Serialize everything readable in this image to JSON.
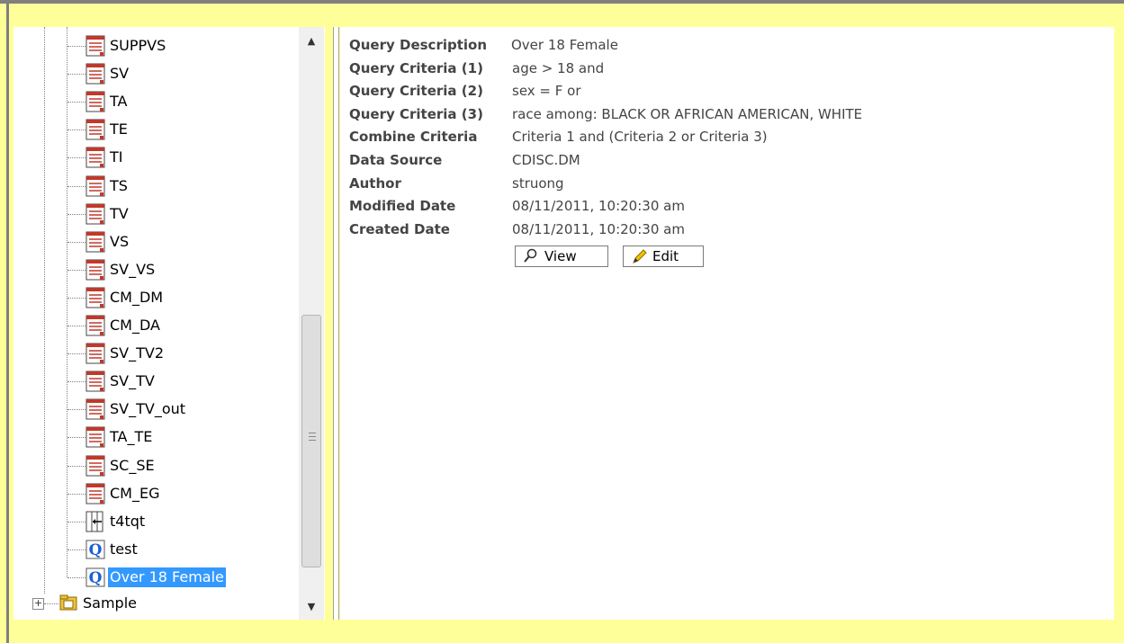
{
  "tree": {
    "items": [
      {
        "label": "SUPPVS",
        "icon": "table-icon"
      },
      {
        "label": "SV",
        "icon": "table-icon"
      },
      {
        "label": "TA",
        "icon": "table-icon"
      },
      {
        "label": "TE",
        "icon": "table-icon"
      },
      {
        "label": "TI",
        "icon": "table-icon"
      },
      {
        "label": "TS",
        "icon": "table-icon"
      },
      {
        "label": "TV",
        "icon": "table-icon"
      },
      {
        "label": "VS",
        "icon": "table-icon"
      },
      {
        "label": "SV_VS",
        "icon": "table-icon"
      },
      {
        "label": "CM_DM",
        "icon": "table-icon"
      },
      {
        "label": "CM_DA",
        "icon": "table-icon"
      },
      {
        "label": "SV_TV2",
        "icon": "table-icon"
      },
      {
        "label": "SV_TV",
        "icon": "table-icon"
      },
      {
        "label": "SV_TV_out",
        "icon": "table-icon"
      },
      {
        "label": "TA_TE",
        "icon": "table-icon"
      },
      {
        "label": "SC_SE",
        "icon": "table-icon"
      },
      {
        "label": "CM_EG",
        "icon": "table-icon"
      },
      {
        "label": "t4tqt",
        "icon": "transpose-icon"
      },
      {
        "label": "test",
        "icon": "query-icon"
      },
      {
        "label": "Over 18 Female",
        "icon": "query-icon",
        "selected": true
      }
    ],
    "folder": {
      "label": "Sample",
      "icon": "folder-icon",
      "expander": "+"
    },
    "scroll": {
      "up": "▲",
      "down": "▼",
      "grip": "≡"
    }
  },
  "details": {
    "rows": [
      {
        "key": "Query Description",
        "value": "Over 18 Female"
      },
      {
        "key": "Query Criteria (1)",
        "value": "age > 18 and"
      },
      {
        "key": "Query Criteria (2)",
        "value": "sex = F or"
      },
      {
        "key": "Query Criteria (3)",
        "value": "race among: BLACK OR AFRICAN AMERICAN, WHITE"
      },
      {
        "key": "Combine Criteria",
        "value": "Criteria 1 and (Criteria 2 or Criteria 3)"
      },
      {
        "key": "Data Source",
        "value": "CDISC.DM"
      },
      {
        "key": "Author",
        "value": "struong"
      },
      {
        "key": "Modified Date",
        "value": "08/11/2011, 10:20:30 am"
      },
      {
        "key": "Created Date",
        "value": "08/11/2011, 10:20:30 am"
      }
    ],
    "buttons": {
      "view": "View",
      "edit": "Edit"
    }
  },
  "colors": {
    "background": "#ffff99",
    "selection": "#3399ff"
  }
}
